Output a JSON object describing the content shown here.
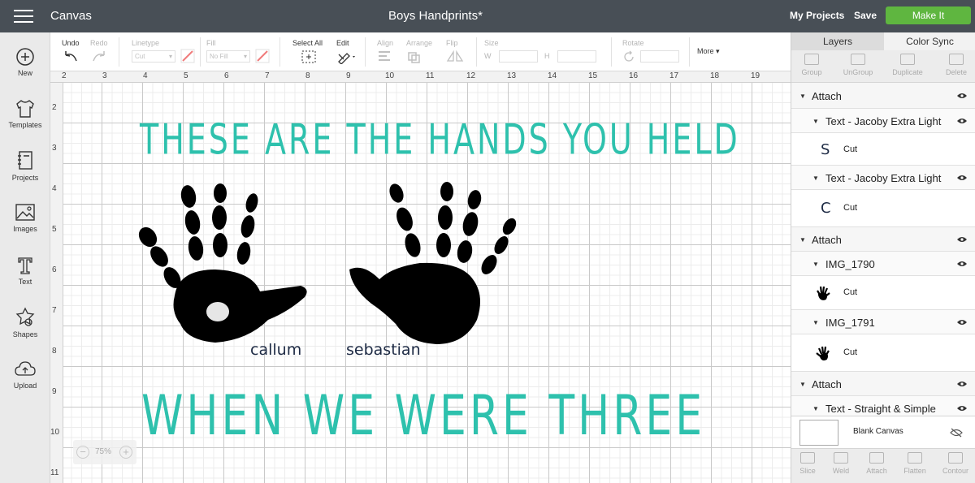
{
  "topbar": {
    "app_title": "Canvas",
    "doc_title": "Boys Handprints*",
    "my_projects": "My Projects",
    "save": "Save",
    "make_it": "Make It",
    "make_it_color": "#5fb640"
  },
  "leftbar": {
    "items": [
      {
        "label": "New",
        "icon": "plus-circle-icon"
      },
      {
        "label": "Templates",
        "icon": "shirt-icon"
      },
      {
        "label": "Projects",
        "icon": "notebook-icon"
      },
      {
        "label": "Images",
        "icon": "image-icon"
      },
      {
        "label": "Text",
        "icon": "text-t-icon"
      },
      {
        "label": "Shapes",
        "icon": "shapes-icon"
      },
      {
        "label": "Upload",
        "icon": "cloud-upload-icon"
      }
    ]
  },
  "toolbar": {
    "undo": "Undo",
    "redo": "Redo",
    "linetype_label": "Linetype",
    "linetype_value": "Cut",
    "fill_label": "Fill",
    "fill_value": "No Fill",
    "select_all": "Select All",
    "edit": "Edit",
    "align": "Align",
    "arrange": "Arrange",
    "flip": "Flip",
    "size": "Size",
    "size_w": "W",
    "size_h": "H",
    "rotate": "Rotate",
    "more": "More"
  },
  "rulers": {
    "top": [
      "2",
      "3",
      "4",
      "5",
      "6",
      "7",
      "8",
      "9",
      "10",
      "11",
      "12",
      "13",
      "14",
      "15",
      "16",
      "17",
      "18",
      "19"
    ],
    "left": [
      "2",
      "3",
      "4",
      "5",
      "6",
      "7",
      "8",
      "9",
      "10",
      "11"
    ]
  },
  "canvas": {
    "line1": "THESE ARE THE HANDS YOU HELD",
    "line2": "WHEN WE WERE THREE",
    "name_left": "callum",
    "name_right": "sebastian",
    "zoom": "75%",
    "text_color": "#2ec1ad",
    "name_color": "#1d2a44"
  },
  "panel": {
    "tab_layers": "Layers",
    "tab_color_sync": "Color Sync",
    "tools": [
      "Group",
      "UnGroup",
      "Duplicate",
      "Delete"
    ],
    "layers": [
      {
        "type": "attach",
        "label": "Attach"
      },
      {
        "type": "group",
        "label": "Text - Jacoby Extra Light"
      },
      {
        "type": "item",
        "thumb": "S",
        "label": "Cut"
      },
      {
        "type": "group",
        "label": "Text - Jacoby Extra Light"
      },
      {
        "type": "item",
        "thumb": "C",
        "label": "Cut"
      },
      {
        "type": "attach",
        "label": "Attach"
      },
      {
        "type": "group",
        "label": "IMG_1790"
      },
      {
        "type": "item",
        "thumb": "hand-left",
        "label": "Cut"
      },
      {
        "type": "group",
        "label": "IMG_1791"
      },
      {
        "type": "item",
        "thumb": "hand-right",
        "label": "Cut"
      },
      {
        "type": "attach",
        "label": "Attach"
      },
      {
        "type": "group",
        "label": "Text - Straight & Simple"
      }
    ],
    "blank_canvas": "Blank Canvas",
    "bottom_tools": [
      "Slice",
      "Weld",
      "Attach",
      "Flatten",
      "Contour"
    ]
  }
}
